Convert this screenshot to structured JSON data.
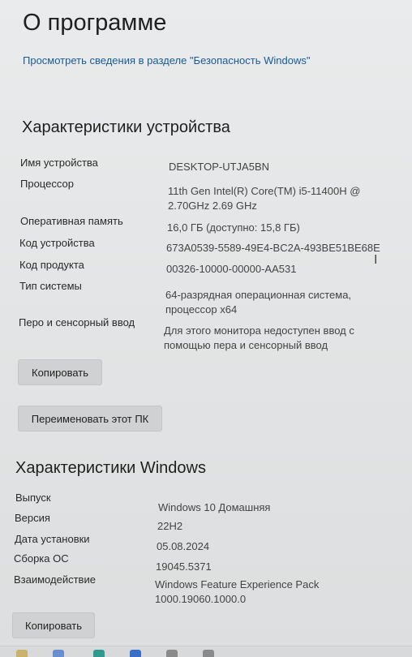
{
  "page": {
    "title": "О программе",
    "security_link": "Просмотреть сведения в разделе \"Безопасность Windows\""
  },
  "device_specs": {
    "title": "Характеристики устройства",
    "rows": [
      {
        "label": "Имя устройства",
        "value": "DESKTOP-UTJA5BN"
      },
      {
        "label": "Процессор",
        "value": "11th Gen Intel(R) Core(TM) i5-11400H @ 2.70GHz   2.69 GHz"
      },
      {
        "label": "Оперативная память",
        "value": "16,0 ГБ (доступно: 15,8 ГБ)"
      },
      {
        "label": "Код устройства",
        "value": "673A0539-5589-49E4-BC2A-493BE51BE68E"
      },
      {
        "label": "Код продукта",
        "value": "00326-10000-00000-AA531"
      },
      {
        "label": "Тип системы",
        "value": "64-разрядная операционная система, процессор x64"
      },
      {
        "label": "Перо и сенсорный ввод",
        "value": "Для этого монитора недоступен ввод с помощью пера и сенсорный ввод"
      }
    ],
    "copy_button": "Копировать",
    "rename_button": "Переименовать этот ПК"
  },
  "windows_specs": {
    "title": "Характеристики Windows",
    "rows": [
      {
        "label": "Выпуск",
        "value": "Windows 10 Домашняя"
      },
      {
        "label": "Версия",
        "value": "22H2"
      },
      {
        "label": "Дата установки",
        "value": "05.08.2024"
      },
      {
        "label": "Сборка ОС",
        "value": "19045.5371"
      },
      {
        "label": "Взаимодействие",
        "value": "Windows Feature Experience Pack 1000.19060.1000.0"
      }
    ],
    "copy_button": "Копировать"
  },
  "taskbar": {
    "icons": [
      "file-explorer-icon",
      "widget-icon",
      "edge-icon",
      "store-icon",
      "app-icon",
      "app-icon"
    ]
  }
}
